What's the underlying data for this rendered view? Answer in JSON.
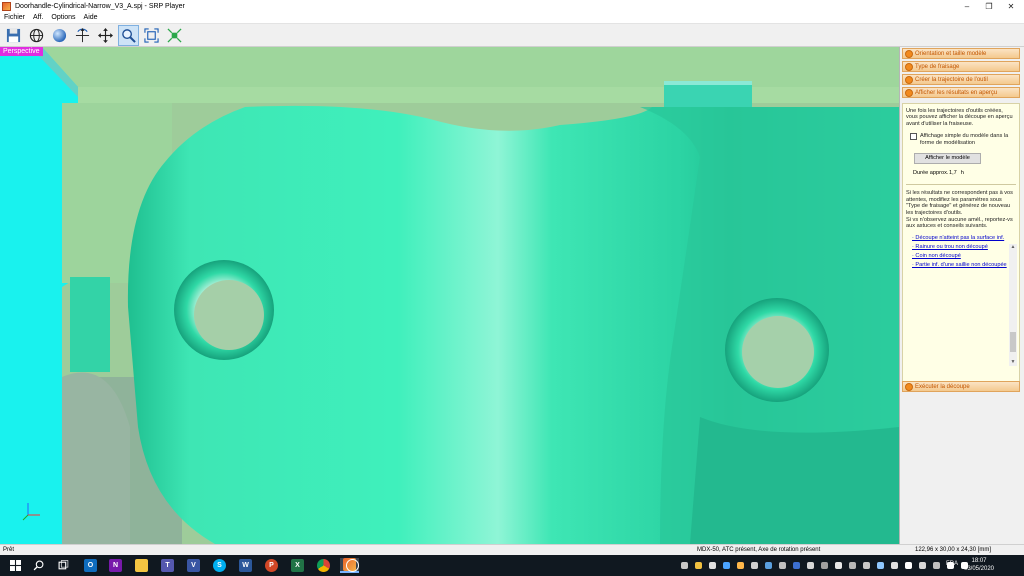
{
  "window": {
    "title": "Doorhandle-Cylindrical-Narrow_V3_A.spj - SRP Player",
    "app_icon": "srp-player-icon",
    "controls": {
      "minimize": "–",
      "maximize": "❐",
      "close": "✕"
    }
  },
  "menu": [
    "Fichier",
    "Aff.",
    "Options",
    "Aide"
  ],
  "toolbar": [
    {
      "name": "save-icon",
      "active": false
    },
    {
      "name": "globe-grid-icon",
      "active": false
    },
    {
      "name": "sphere-icon",
      "active": false
    },
    {
      "name": "rotate-axes-icon",
      "active": false
    },
    {
      "name": "pan-arrows-icon",
      "active": false
    },
    {
      "name": "zoom-icon",
      "active": true
    },
    {
      "name": "fit-frame-icon",
      "active": false
    },
    {
      "name": "fit-all-icon",
      "active": false
    }
  ],
  "viewport": {
    "label": "Perspective"
  },
  "panel": {
    "steps": [
      "Orientation et taille modèle",
      "Type de fraisage",
      "Créer la trajectoire de l'outil",
      "Afficher les résultats en aperçu"
    ],
    "intro": "Une fois les trajectoires d'outils créées, vous pouvez afficher la découpe en aperçu avant d'utiliser la fraiseuse.",
    "checkbox_label": "Affichage simple du modèle dans la forme de modélisation",
    "checkbox_checked": false,
    "show_model_button": "Afficher le modèle",
    "duration_label": "Durée approx.",
    "duration_value": "1,7",
    "duration_unit": "h",
    "advice1": "Si les résultats ne correspondent pas à vos attentes, modifiez les paramètres sous \"Type de fraisage\" et générez de nouveau les trajectoires d'outils.",
    "advice2": "Si vs n'observez aucune amél., reportez-vs aux astuces et conseils suivants.",
    "links": [
      "· Découpe n'atteint pas la surface inf.",
      "· Rainure ou trou non découpé",
      "· Coin non découpé",
      "· Partie inf. d'une saillie non découpée"
    ],
    "execute_step": "Exécuter la découpe"
  },
  "status": {
    "left": "Prêt",
    "middle": "MDX-50, ATC présent, Axe de rotation présent",
    "right": "122,96 x 30,00 x 24,30 [mm]"
  },
  "taskbar": {
    "apps": [
      "windows-start-icon",
      "search-icon",
      "task-view-icon",
      "outlook-icon",
      "onenote-icon",
      "file-explorer-icon",
      "teams-icon",
      "visio-icon",
      "skype-icon",
      "word-icon",
      "powerpoint-icon",
      "excel-icon",
      "chrome-icon",
      "srp-player-taskbar-icon",
      "drive-icon"
    ],
    "language": "FRA",
    "time": "18:07",
    "date": "03/05/2020"
  },
  "colors": {
    "model": "#3ee6b4",
    "model_dark": "#1fae86",
    "background_green": "#9ecc9a",
    "cyan_face": "#19f2ee",
    "view_label": "#e02de0",
    "step_text": "#c25600",
    "panel_content_bg": "#ffffe6"
  }
}
